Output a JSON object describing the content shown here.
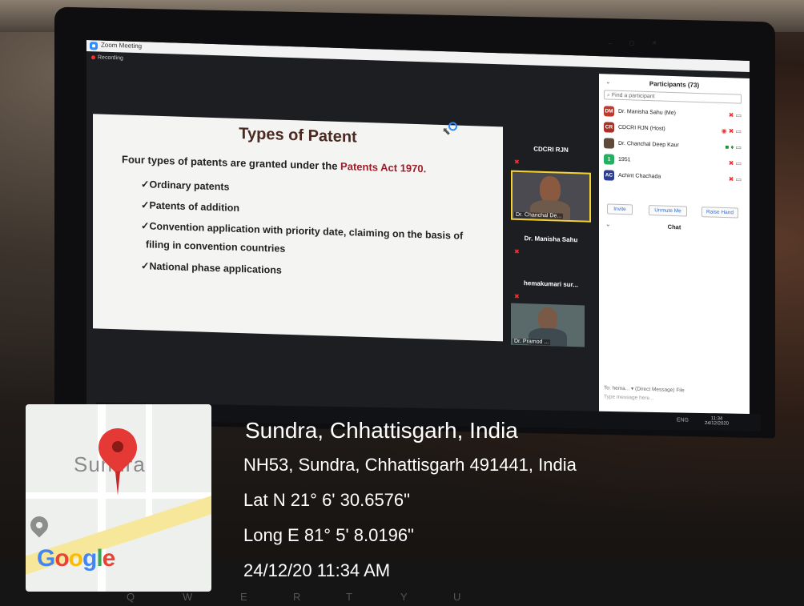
{
  "zoom": {
    "window_title": "Zoom Meeting",
    "recording_label": "Recording",
    "window_controls": "– ▢ ✕"
  },
  "slide": {
    "title": "Types of Patent",
    "intro_prefix": "Four types of patents are granted under the ",
    "intro_highlight": "Patents Act 1970.",
    "bullets": [
      "✓Ordinary patents",
      "✓Patents of addition",
      "✓Convention application with priority date, claiming on the basis of",
      "filing in convention countries",
      "✓National phase applications"
    ]
  },
  "videos": {
    "top_name": "CDCRI RJN",
    "tile1_caption": "Dr. Chanchal De...",
    "name2": "Dr. Manisha Sahu",
    "name3": "hemakumari sur...",
    "tile2_caption": "Dr. Pramod ..."
  },
  "participants": {
    "header": "Participants (73)",
    "search_placeholder": "Find a participant",
    "list": [
      {
        "initials": "DM",
        "name": "Dr. Manisha Sahu (Me)",
        "color": "#c0392b"
      },
      {
        "initials": "CR",
        "name": "CDCRI RJN (Host)",
        "color": "#a93226"
      },
      {
        "initials": "",
        "name": "Dr. Chanchal Deep Kaur",
        "color": "#5d4a3a"
      },
      {
        "initials": "1",
        "name": "1951",
        "color": "#27ae60"
      },
      {
        "initials": "AC",
        "name": "Achint Chachada",
        "color": "#2c3e91"
      }
    ],
    "buttons": [
      "Invite",
      "Unmute Me",
      "Raise Hand"
    ]
  },
  "chat": {
    "header": "Chat",
    "to_line": "To: hema... ▾ (Direct Message) File",
    "placeholder": "Type message here..."
  },
  "taskbar": {
    "time": "11:34",
    "date": "24/12/2020",
    "tray": "ENG"
  },
  "map": {
    "town_label": "Sundra",
    "google_letters": [
      "G",
      "o",
      "o",
      "g",
      "l",
      "e"
    ]
  },
  "location": {
    "place": "Sundra, Chhattisgarh, India",
    "address": "NH53, Sundra, Chhattisgarh 491441, India",
    "lat": "Lat N 21° 6' 30.6576\"",
    "long": "Long E 81° 5' 8.0196\"",
    "datetime": "24/12/20 11:34 AM"
  },
  "keyboard": {
    "keys": [
      "Q",
      "W",
      "E",
      "R",
      "T",
      "Y",
      "U"
    ]
  }
}
